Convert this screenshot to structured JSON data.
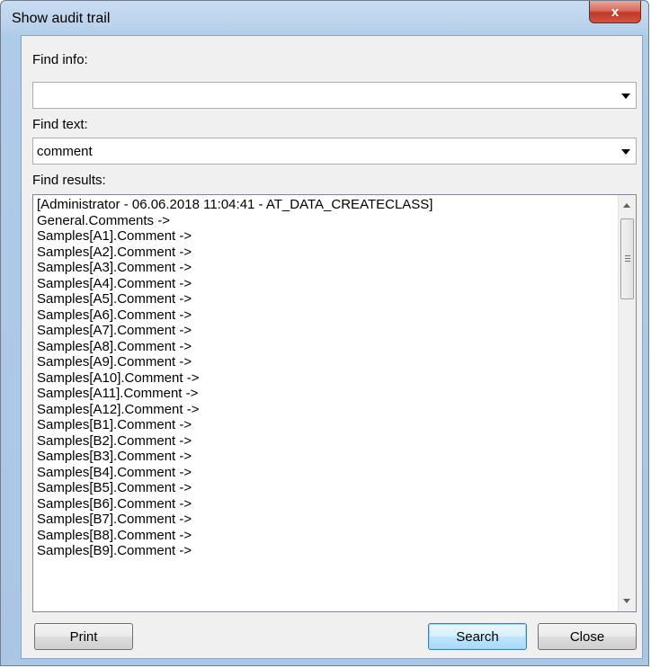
{
  "window": {
    "title": "Show audit trail",
    "close_glyph": "x"
  },
  "find_info": {
    "label": "Find info:",
    "value": ""
  },
  "find_text": {
    "label": "Find text:",
    "value": "comment"
  },
  "find_results": {
    "label": "Find results:",
    "lines": [
      "[Administrator - 06.06.2018 11:04:41 - AT_DATA_CREATECLASS]",
      "General.Comments ->",
      "Samples[A1].Comment ->",
      "Samples[A2].Comment ->",
      "Samples[A3].Comment ->",
      "Samples[A4].Comment ->",
      "Samples[A5].Comment ->",
      "Samples[A6].Comment ->",
      "Samples[A7].Comment ->",
      "Samples[A8].Comment ->",
      "Samples[A9].Comment ->",
      "Samples[A10].Comment ->",
      "Samples[A11].Comment ->",
      "Samples[A12].Comment ->",
      "Samples[B1].Comment ->",
      "Samples[B2].Comment ->",
      "Samples[B3].Comment ->",
      "Samples[B4].Comment ->",
      "Samples[B5].Comment ->",
      "Samples[B6].Comment ->",
      "Samples[B7].Comment ->",
      "Samples[B8].Comment ->",
      "Samples[B9].Comment ->"
    ]
  },
  "buttons": {
    "print": "Print",
    "search": "Search",
    "close": "Close"
  },
  "icons": {
    "dropdown": "chevron-down-icon",
    "scroll_up": "scroll-up-icon",
    "scroll_down": "scroll-down-icon",
    "close": "close-icon"
  }
}
